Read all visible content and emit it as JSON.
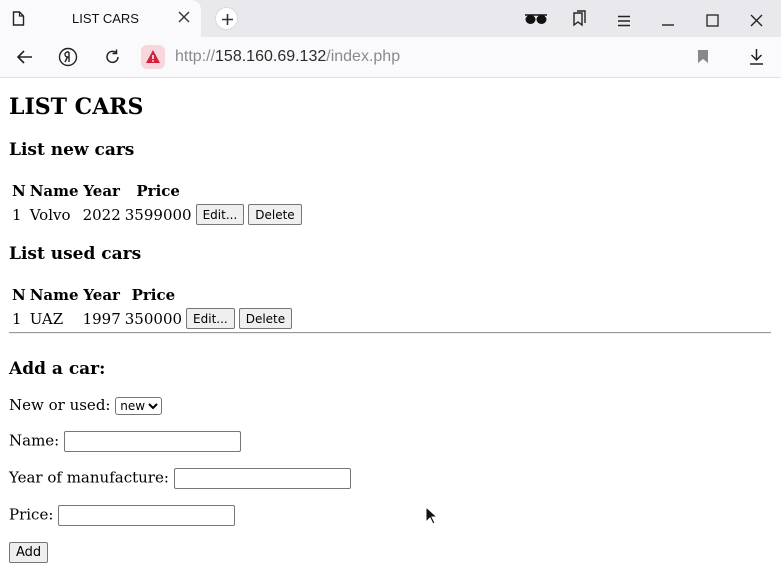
{
  "browser": {
    "tab_title": "LIST CARS",
    "url_scheme": "http://",
    "url_host": "158.160.69.132",
    "url_path": "/index.php"
  },
  "page": {
    "heading": "LIST CARS",
    "new_cars": {
      "heading": "List new cars",
      "columns": [
        "N",
        "Name",
        "Year",
        "Price"
      ],
      "rows": [
        {
          "n": "1",
          "name": "Volvo",
          "year": "2022",
          "price": "3599000"
        }
      ]
    },
    "used_cars": {
      "heading": "List used cars",
      "columns": [
        "N",
        "Name",
        "Year",
        "Price"
      ],
      "rows": [
        {
          "n": "1",
          "name": "UAZ",
          "year": "1997",
          "price": "350000"
        }
      ]
    },
    "edit_label": "Edit...",
    "delete_label": "Delete",
    "form": {
      "heading": "Add a car:",
      "type_label": "New or used:",
      "type_selected": "new",
      "name_label": "Name:",
      "name_value": "",
      "year_label": "Year of manufacture:",
      "year_value": "",
      "price_label": "Price:",
      "price_value": "",
      "submit_label": "Add"
    }
  }
}
